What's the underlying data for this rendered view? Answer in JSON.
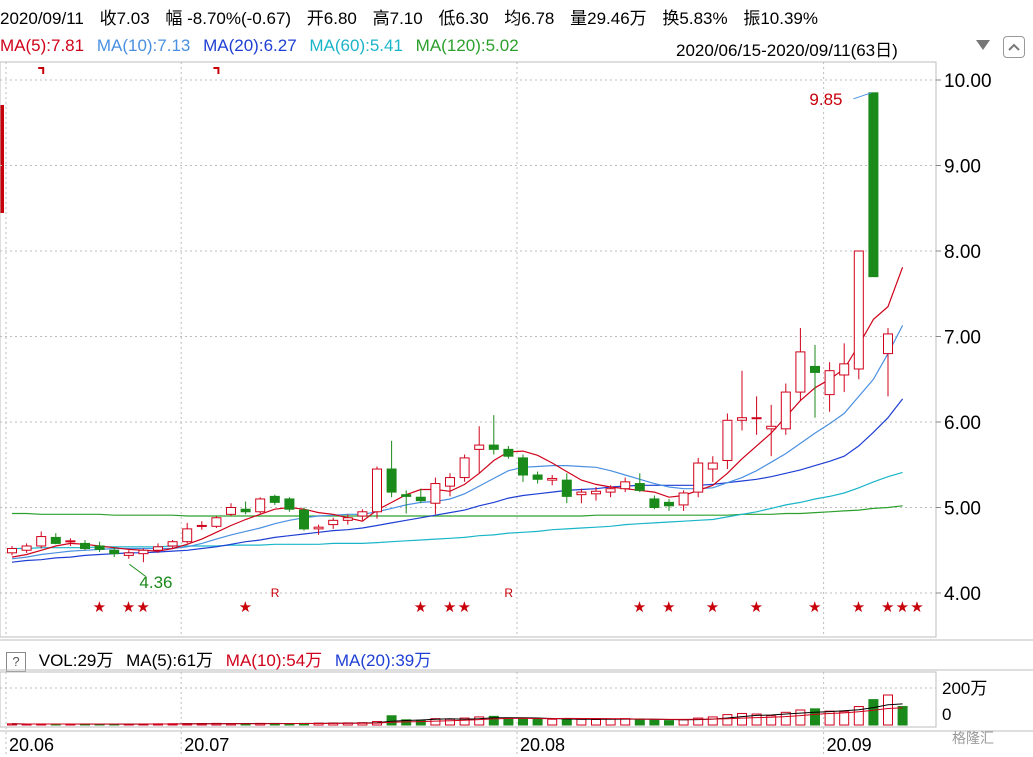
{
  "header": {
    "date": "2020/09/11",
    "close": {
      "label": "收",
      "value": "7.03"
    },
    "change": {
      "label": "幅",
      "value": "-8.70%(-0.67)"
    },
    "open": {
      "label": "开",
      "value": "6.80"
    },
    "high": {
      "label": "高",
      "value": "7.10"
    },
    "low": {
      "label": "低",
      "value": "6.30"
    },
    "avg": {
      "label": "均",
      "value": "6.78"
    },
    "volume": {
      "label": "量",
      "value": "29.46万"
    },
    "turnover": {
      "label": "换",
      "value": "5.83%"
    },
    "amplitude": {
      "label": "振",
      "value": "10.39%"
    }
  },
  "ma_legend": [
    {
      "text": "MA(5):7.81",
      "color": "#d0021b"
    },
    {
      "text": "MA(10):7.13",
      "color": "#4a90e2"
    },
    {
      "text": "MA(20):6.27",
      "color": "#1f3fd4"
    },
    {
      "text": "MA(60):5.41",
      "color": "#1bb5c9"
    },
    {
      "text": "MA(120):5.02",
      "color": "#2ca02c"
    }
  ],
  "date_range": "2020/06/15-2020/09/11(63日)",
  "volume_legend": {
    "help": "?",
    "vol": "VOL:29万",
    "ma5": "MA(5):61万",
    "ma10": "MA(10):54万",
    "ma20": "MA(20):39万",
    "colors": {
      "vol": "#000000",
      "ma5": "#000000",
      "ma10": "#d0021b",
      "ma20": "#1f3fd4"
    }
  },
  "logo_text": "格隆汇",
  "colors": {
    "up": "#d0021b",
    "down": "#1a8a1a",
    "grid": "#c8c8c8",
    "annot_high": "#c8000a",
    "annot_low": "#1a8a1a"
  },
  "chart_data": {
    "type": "candlestick",
    "y_ticks": [
      "10.00",
      "9.00",
      "8.00",
      "7.00",
      "6.00",
      "5.00",
      "4.00"
    ],
    "ylim": [
      3.5,
      10.2
    ],
    "x_ticks": [
      {
        "label": "20.06",
        "index": 0
      },
      {
        "label": "20.07",
        "index": 12
      },
      {
        "label": "20.08",
        "index": 35
      },
      {
        "label": "20.09",
        "index": 56
      }
    ],
    "volume_ticks": [
      "200万",
      "0"
    ],
    "annotations": {
      "high": "9.85",
      "low": "4.36"
    },
    "markers": {
      "star": "★",
      "r": "R"
    },
    "candles": [
      {
        "o": 4.47,
        "h": 4.55,
        "l": 4.44,
        "c": 4.52
      },
      {
        "o": 4.5,
        "h": 4.58,
        "l": 4.47,
        "c": 4.55
      },
      {
        "o": 4.55,
        "h": 4.72,
        "l": 4.52,
        "c": 4.66
      },
      {
        "o": 4.65,
        "h": 4.7,
        "l": 4.57,
        "c": 4.58
      },
      {
        "o": 4.6,
        "h": 4.64,
        "l": 4.55,
        "c": 4.61
      },
      {
        "o": 4.58,
        "h": 4.62,
        "l": 4.5,
        "c": 4.52
      },
      {
        "o": 4.55,
        "h": 4.6,
        "l": 4.48,
        "c": 4.51
      },
      {
        "o": 4.5,
        "h": 4.53,
        "l": 4.42,
        "c": 4.46
      },
      {
        "o": 4.44,
        "h": 4.5,
        "l": 4.4,
        "c": 4.47
      },
      {
        "o": 4.46,
        "h": 4.52,
        "l": 4.36,
        "c": 4.5
      },
      {
        "o": 4.5,
        "h": 4.58,
        "l": 4.47,
        "c": 4.54
      },
      {
        "o": 4.55,
        "h": 4.62,
        "l": 4.52,
        "c": 4.6
      },
      {
        "o": 4.6,
        "h": 4.82,
        "l": 4.58,
        "c": 4.75
      },
      {
        "o": 4.78,
        "h": 4.84,
        "l": 4.74,
        "c": 4.79
      },
      {
        "o": 4.78,
        "h": 4.9,
        "l": 4.76,
        "c": 4.88
      },
      {
        "o": 4.92,
        "h": 5.05,
        "l": 4.9,
        "c": 5.0
      },
      {
        "o": 4.98,
        "h": 5.07,
        "l": 4.92,
        "c": 4.95
      },
      {
        "o": 4.95,
        "h": 5.12,
        "l": 4.93,
        "c": 5.1
      },
      {
        "o": 5.13,
        "h": 5.15,
        "l": 5.03,
        "c": 5.06
      },
      {
        "o": 5.1,
        "h": 5.12,
        "l": 4.95,
        "c": 4.98
      },
      {
        "o": 4.97,
        "h": 5.0,
        "l": 4.73,
        "c": 4.75
      },
      {
        "o": 4.75,
        "h": 4.8,
        "l": 4.68,
        "c": 4.77
      },
      {
        "o": 4.8,
        "h": 4.88,
        "l": 4.75,
        "c": 4.85
      },
      {
        "o": 4.85,
        "h": 4.92,
        "l": 4.8,
        "c": 4.88
      },
      {
        "o": 4.9,
        "h": 4.98,
        "l": 4.85,
        "c": 4.95
      },
      {
        "o": 4.95,
        "h": 5.48,
        "l": 4.87,
        "c": 5.45
      },
      {
        "o": 5.45,
        "h": 5.78,
        "l": 5.12,
        "c": 5.18
      },
      {
        "o": 5.15,
        "h": 5.2,
        "l": 4.93,
        "c": 5.13
      },
      {
        "o": 5.12,
        "h": 5.22,
        "l": 5.05,
        "c": 5.08
      },
      {
        "o": 5.05,
        "h": 5.35,
        "l": 4.92,
        "c": 5.28
      },
      {
        "o": 5.25,
        "h": 5.4,
        "l": 5.13,
        "c": 5.35
      },
      {
        "o": 5.35,
        "h": 5.62,
        "l": 5.3,
        "c": 5.58
      },
      {
        "o": 5.68,
        "h": 5.95,
        "l": 5.4,
        "c": 5.73
      },
      {
        "o": 5.73,
        "h": 6.08,
        "l": 5.62,
        "c": 5.68
      },
      {
        "o": 5.68,
        "h": 5.72,
        "l": 5.57,
        "c": 5.6
      },
      {
        "o": 5.58,
        "h": 5.62,
        "l": 5.3,
        "c": 5.38
      },
      {
        "o": 5.38,
        "h": 5.42,
        "l": 5.28,
        "c": 5.33
      },
      {
        "o": 5.32,
        "h": 5.38,
        "l": 5.26,
        "c": 5.34
      },
      {
        "o": 5.32,
        "h": 5.4,
        "l": 5.05,
        "c": 5.13
      },
      {
        "o": 5.15,
        "h": 5.22,
        "l": 5.05,
        "c": 5.18
      },
      {
        "o": 5.16,
        "h": 5.24,
        "l": 5.08,
        "c": 5.19
      },
      {
        "o": 5.18,
        "h": 5.26,
        "l": 5.12,
        "c": 5.22
      },
      {
        "o": 5.22,
        "h": 5.35,
        "l": 5.18,
        "c": 5.3
      },
      {
        "o": 5.28,
        "h": 5.4,
        "l": 5.18,
        "c": 5.2
      },
      {
        "o": 5.1,
        "h": 5.14,
        "l": 4.98,
        "c": 5.0
      },
      {
        "o": 5.06,
        "h": 5.1,
        "l": 4.96,
        "c": 5.02
      },
      {
        "o": 5.03,
        "h": 5.2,
        "l": 4.96,
        "c": 5.17
      },
      {
        "o": 5.18,
        "h": 5.58,
        "l": 5.12,
        "c": 5.52
      },
      {
        "o": 5.45,
        "h": 5.6,
        "l": 5.3,
        "c": 5.52
      },
      {
        "o": 5.55,
        "h": 6.1,
        "l": 5.45,
        "c": 6.02
      },
      {
        "o": 6.02,
        "h": 6.6,
        "l": 5.9,
        "c": 6.05
      },
      {
        "o": 6.05,
        "h": 6.3,
        "l": 5.85,
        "c": 6.05
      },
      {
        "o": 5.92,
        "h": 6.2,
        "l": 5.6,
        "c": 5.95
      },
      {
        "o": 5.92,
        "h": 6.45,
        "l": 5.85,
        "c": 6.35
      },
      {
        "o": 6.35,
        "h": 7.1,
        "l": 6.25,
        "c": 6.82
      },
      {
        "o": 6.65,
        "h": 6.9,
        "l": 6.05,
        "c": 6.58
      },
      {
        "o": 6.32,
        "h": 6.7,
        "l": 6.12,
        "c": 6.6
      },
      {
        "o": 6.55,
        "h": 6.92,
        "l": 6.35,
        "c": 6.68
      },
      {
        "o": 6.62,
        "h": 8.0,
        "l": 6.5,
        "c": 8.0
      },
      {
        "o": 9.85,
        "h": 9.85,
        "l": 7.7,
        "c": 7.7
      },
      {
        "o": 6.8,
        "h": 7.1,
        "l": 6.3,
        "c": 7.03
      }
    ],
    "volume": [
      10,
      8,
      9,
      7,
      8,
      9,
      8,
      7,
      8,
      9,
      10,
      11,
      12,
      13,
      14,
      12,
      12,
      14,
      14,
      13,
      14,
      16,
      17,
      18,
      20,
      30,
      80,
      45,
      40,
      55,
      50,
      60,
      70,
      75,
      58,
      52,
      48,
      50,
      52,
      50,
      48,
      52,
      55,
      50,
      42,
      38,
      45,
      60,
      70,
      90,
      100,
      95,
      80,
      110,
      130,
      140,
      120,
      115,
      160,
      220,
      260,
      160
    ],
    "volume_up": [
      true,
      true,
      true,
      false,
      true,
      false,
      false,
      false,
      true,
      true,
      true,
      true,
      true,
      true,
      true,
      true,
      false,
      true,
      false,
      false,
      false,
      true,
      true,
      true,
      true,
      true,
      false,
      false,
      false,
      true,
      true,
      true,
      true,
      false,
      false,
      false,
      false,
      true,
      false,
      true,
      true,
      true,
      true,
      false,
      false,
      false,
      true,
      true,
      true,
      true,
      true,
      true,
      true,
      true,
      true,
      false,
      true,
      true,
      true,
      false,
      true,
      false
    ],
    "ma5": [
      4.42,
      4.45,
      4.5,
      4.55,
      4.58,
      4.57,
      4.55,
      4.53,
      4.51,
      4.5,
      4.49,
      4.52,
      4.57,
      4.63,
      4.71,
      4.79,
      4.86,
      4.92,
      4.98,
      5.0,
      4.98,
      4.94,
      4.92,
      4.88,
      4.84,
      4.97,
      5.06,
      5.15,
      5.21,
      5.21,
      5.19,
      5.27,
      5.4,
      5.55,
      5.65,
      5.66,
      5.61,
      5.52,
      5.42,
      5.32,
      5.27,
      5.24,
      5.22,
      5.2,
      5.18,
      5.12,
      5.14,
      5.2,
      5.26,
      5.4,
      5.57,
      5.72,
      5.87,
      6.06,
      6.25,
      6.4,
      6.5,
      6.62,
      6.9,
      7.2,
      7.35,
      7.81
    ],
    "ma10": [
      4.4,
      4.42,
      4.45,
      4.47,
      4.49,
      4.5,
      4.51,
      4.52,
      4.52,
      4.52,
      4.52,
      4.52,
      4.54,
      4.58,
      4.63,
      4.68,
      4.72,
      4.76,
      4.81,
      4.85,
      4.88,
      4.9,
      4.91,
      4.92,
      4.92,
      4.95,
      4.99,
      5.03,
      5.06,
      5.07,
      5.1,
      5.16,
      5.25,
      5.34,
      5.43,
      5.47,
      5.48,
      5.49,
      5.49,
      5.48,
      5.47,
      5.43,
      5.38,
      5.33,
      5.28,
      5.24,
      5.22,
      5.22,
      5.23,
      5.29,
      5.35,
      5.43,
      5.53,
      5.63,
      5.75,
      5.87,
      5.98,
      6.1,
      6.3,
      6.5,
      6.8,
      7.13
    ],
    "ma20": [
      4.36,
      4.38,
      4.39,
      4.41,
      4.42,
      4.44,
      4.45,
      4.46,
      4.47,
      4.47,
      4.48,
      4.49,
      4.5,
      4.52,
      4.54,
      4.57,
      4.6,
      4.62,
      4.65,
      4.67,
      4.69,
      4.71,
      4.73,
      4.74,
      4.76,
      4.79,
      4.82,
      4.85,
      4.88,
      4.91,
      4.94,
      4.97,
      5.02,
      5.06,
      5.11,
      5.14,
      5.16,
      5.18,
      5.2,
      5.21,
      5.22,
      5.24,
      5.25,
      5.26,
      5.26,
      5.26,
      5.26,
      5.26,
      5.27,
      5.29,
      5.31,
      5.33,
      5.36,
      5.4,
      5.44,
      5.49,
      5.54,
      5.6,
      5.72,
      5.88,
      6.05,
      6.27
    ],
    "ma60": [
      4.52,
      4.52,
      4.53,
      4.53,
      4.53,
      4.53,
      4.54,
      4.54,
      4.54,
      4.54,
      4.54,
      4.55,
      4.55,
      4.55,
      4.55,
      4.56,
      4.56,
      4.56,
      4.57,
      4.57,
      4.57,
      4.57,
      4.58,
      4.58,
      4.58,
      4.59,
      4.6,
      4.61,
      4.62,
      4.63,
      4.64,
      4.65,
      4.67,
      4.68,
      4.7,
      4.71,
      4.72,
      4.74,
      4.75,
      4.76,
      4.77,
      4.78,
      4.8,
      4.81,
      4.82,
      4.83,
      4.84,
      4.85,
      4.86,
      4.89,
      4.92,
      4.95,
      4.99,
      5.03,
      5.06,
      5.1,
      5.13,
      5.17,
      5.23,
      5.3,
      5.36,
      5.41
    ],
    "ma120": [
      4.93,
      4.93,
      4.92,
      4.92,
      4.92,
      4.92,
      4.92,
      4.91,
      4.91,
      4.91,
      4.91,
      4.91,
      4.9,
      4.9,
      4.9,
      4.9,
      4.9,
      4.9,
      4.9,
      4.9,
      4.9,
      4.9,
      4.9,
      4.9,
      4.9,
      4.9,
      4.9,
      4.9,
      4.9,
      4.9,
      4.9,
      4.9,
      4.9,
      4.9,
      4.9,
      4.9,
      4.9,
      4.9,
      4.9,
      4.9,
      4.91,
      4.91,
      4.91,
      4.91,
      4.91,
      4.91,
      4.91,
      4.91,
      4.91,
      4.91,
      4.92,
      4.92,
      4.92,
      4.93,
      4.93,
      4.94,
      4.95,
      4.96,
      4.97,
      4.99,
      5.0,
      5.02
    ],
    "star_indices": [
      6,
      8,
      9,
      16,
      28,
      30,
      31,
      43,
      45,
      48,
      51,
      55,
      58,
      60,
      61,
      62
    ],
    "r_indices": [
      18,
      34
    ],
    "flag_indices": [
      2,
      14
    ]
  }
}
